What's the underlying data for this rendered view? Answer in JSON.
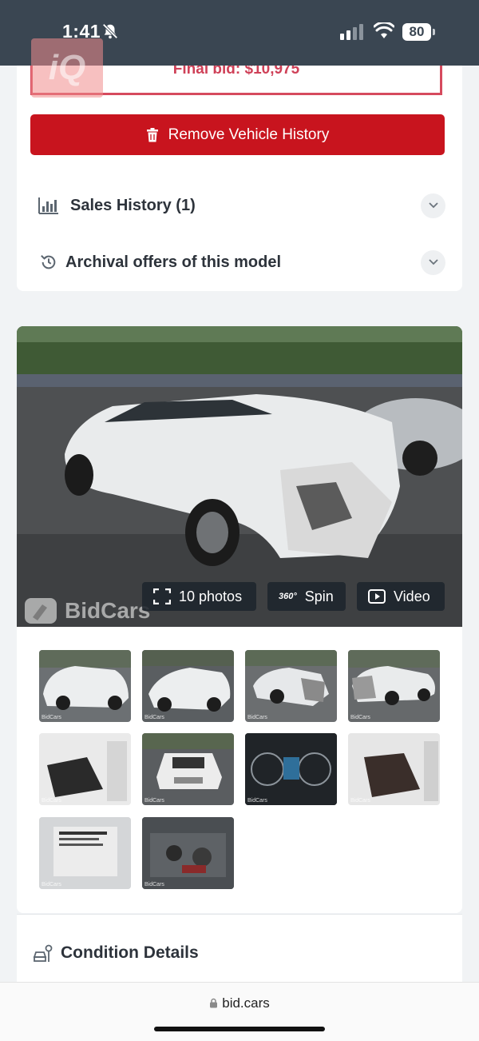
{
  "status_bar": {
    "time": "1:41",
    "battery": "80"
  },
  "top_card": {
    "final_bid": "Final bid: $10,975",
    "remove_button": "Remove Vehicle History",
    "iq_logo": "iQ",
    "rows": [
      {
        "label": "Sales History (1)",
        "icon": "bar-chart-icon"
      },
      {
        "label": "Archival offers of this model",
        "icon": "history-icon"
      }
    ]
  },
  "gallery": {
    "watermark": "BidCars",
    "buttons": {
      "photos": "10 photos",
      "spin": "Spin",
      "spin_badge": "360°",
      "video": "Video"
    },
    "thumb_watermark": "BidCars"
  },
  "condition": {
    "label": "Condition Details",
    "icon": "car-wrench-icon"
  },
  "browser": {
    "url": "bid.cars"
  },
  "colors": {
    "accent_red": "#c8141e",
    "final_bid_red": "#cf4158",
    "status_bar": "#3a4652"
  }
}
